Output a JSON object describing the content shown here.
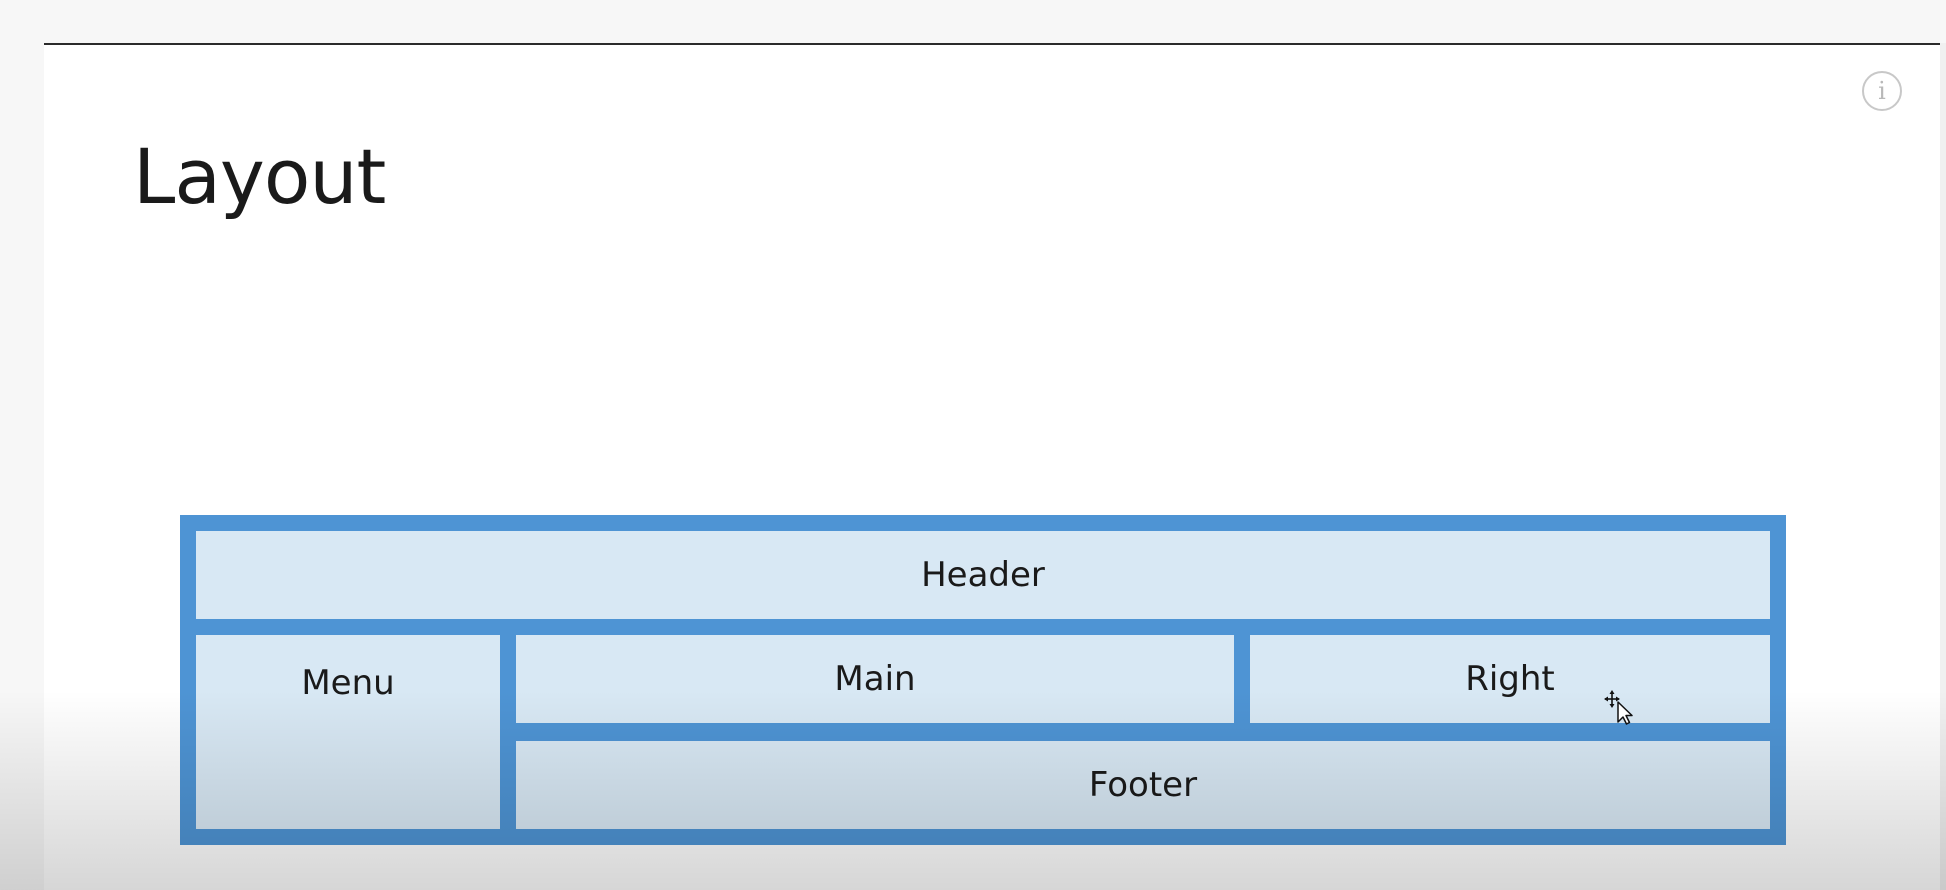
{
  "slide": {
    "title": "Layout",
    "info_icon_glyph": "i"
  },
  "diagram": {
    "frame_color": "#4e94d4",
    "cell_color": "#d8e8f4",
    "regions": {
      "header": "Header",
      "menu": "Menu",
      "main": "Main",
      "right": "Right",
      "footer": "Footer"
    }
  },
  "icons": {
    "info": "info-icon",
    "cursor": "move-cursor-icon"
  }
}
